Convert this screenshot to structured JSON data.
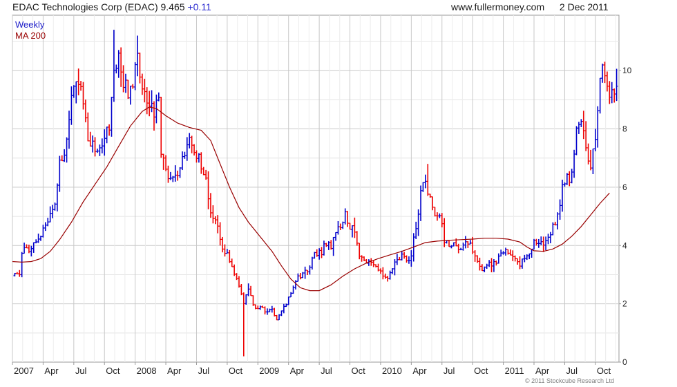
{
  "header": {
    "title": "EDAC Technologies Corp (EDAC)",
    "last_price": "9.465",
    "change": "+0.11",
    "source": "www.fullermoney.com",
    "date": "2 Dec 2011"
  },
  "copyright": "© 2011 Stockcube Research Ltd",
  "colors": {
    "up": "#0000cc",
    "down": "#ee0000",
    "ma": "#990000",
    "grid": "#d8d8d8",
    "legend_weekly": "#1a1ac8",
    "legend_ma": "#990000"
  },
  "chart_data": {
    "type": "candlestick-ohlc",
    "legend": [
      "Weekly",
      "MA 200"
    ],
    "grid": true,
    "legend_placement": "top-left",
    "ylim": [
      0,
      11.9
    ],
    "y_ticks": [
      0,
      2,
      4,
      6,
      8,
      10
    ],
    "x_labels": [
      "2007",
      "Apr",
      "Jul",
      "Oct",
      "2008",
      "Apr",
      "Jul",
      "Oct",
      "2009",
      "Apr",
      "Jul",
      "Oct",
      "2010",
      "Apr",
      "Jul",
      "Oct",
      "2011",
      "Apr",
      "Jul",
      "Oct"
    ],
    "x_start_week": 0,
    "x_end_week": 257,
    "price_path": [
      [
        0,
        3.0
      ],
      [
        3,
        3.1
      ],
      [
        4,
        3.8
      ],
      [
        7,
        3.9
      ],
      [
        10,
        4.0
      ],
      [
        12,
        4.4
      ],
      [
        15,
        4.8
      ],
      [
        18,
        5.4
      ],
      [
        20,
        7.0
      ],
      [
        22,
        7.1
      ],
      [
        24,
        8.5
      ],
      [
        26,
        9.5
      ],
      [
        28,
        9.3
      ],
      [
        30,
        9.0
      ],
      [
        32,
        7.8
      ],
      [
        34,
        7.5
      ],
      [
        37,
        7.4
      ],
      [
        39,
        7.5
      ],
      [
        41,
        8.2
      ],
      [
        43,
        10.2
      ],
      [
        45,
        10.5
      ],
      [
        47,
        9.5
      ],
      [
        49,
        9.2
      ],
      [
        51,
        9.5
      ],
      [
        53,
        10.3
      ],
      [
        55,
        9.2
      ],
      [
        58,
        9.0
      ],
      [
        60,
        8.5
      ],
      [
        62,
        9.0
      ],
      [
        63,
        7.0
      ],
      [
        66,
        6.4
      ],
      [
        68,
        6.3
      ],
      [
        71,
        6.6
      ],
      [
        73,
        7.2
      ],
      [
        75,
        7.7
      ],
      [
        77,
        7.4
      ],
      [
        79,
        6.9
      ],
      [
        82,
        6.2
      ],
      [
        84,
        5.0
      ],
      [
        87,
        4.6
      ],
      [
        89,
        4.0
      ],
      [
        91,
        3.7
      ],
      [
        93,
        3.2
      ],
      [
        96,
        2.7
      ],
      [
        98,
        2.0
      ],
      [
        100,
        2.5
      ],
      [
        103,
        1.8
      ],
      [
        105,
        1.9
      ],
      [
        108,
        1.7
      ],
      [
        110,
        1.8
      ],
      [
        112,
        1.5
      ],
      [
        114,
        1.7
      ],
      [
        117,
        2.2
      ],
      [
        120,
        2.8
      ],
      [
        123,
        3.0
      ],
      [
        126,
        3.3
      ],
      [
        128,
        3.7
      ],
      [
        131,
        3.8
      ],
      [
        133,
        4.1
      ],
      [
        135,
        3.9
      ],
      [
        137,
        4.5
      ],
      [
        139,
        4.6
      ],
      [
        141,
        5.0
      ],
      [
        143,
        4.7
      ],
      [
        145,
        4.5
      ],
      [
        147,
        3.7
      ],
      [
        149,
        3.5
      ],
      [
        151,
        3.5
      ],
      [
        153,
        3.3
      ],
      [
        155,
        3.1
      ],
      [
        157,
        3.0
      ],
      [
        159,
        2.9
      ],
      [
        161,
        3.2
      ],
      [
        163,
        3.5
      ],
      [
        165,
        3.6
      ],
      [
        167,
        3.5
      ],
      [
        169,
        3.7
      ],
      [
        171,
        4.6
      ],
      [
        173,
        5.8
      ],
      [
        175,
        6.1
      ],
      [
        177,
        5.6
      ],
      [
        179,
        5.0
      ],
      [
        181,
        5.2
      ],
      [
        183,
        4.2
      ],
      [
        185,
        4.0
      ],
      [
        187,
        4.1
      ],
      [
        189,
        3.9
      ],
      [
        191,
        4.0
      ],
      [
        193,
        4.1
      ],
      [
        195,
        3.8
      ],
      [
        197,
        3.5
      ],
      [
        199,
        3.2
      ],
      [
        201,
        3.3
      ],
      [
        203,
        3.4
      ],
      [
        205,
        3.5
      ],
      [
        207,
        3.7
      ],
      [
        209,
        3.8
      ],
      [
        211,
        3.6
      ],
      [
        213,
        3.5
      ],
      [
        215,
        3.4
      ],
      [
        217,
        3.5
      ],
      [
        219,
        3.6
      ],
      [
        221,
        4.1
      ],
      [
        223,
        4.2
      ],
      [
        225,
        4.1
      ],
      [
        227,
        4.4
      ],
      [
        229,
        4.6
      ],
      [
        231,
        5.0
      ],
      [
        233,
        6.1
      ],
      [
        235,
        6.3
      ],
      [
        237,
        6.4
      ],
      [
        239,
        7.8
      ],
      [
        241,
        8.3
      ],
      [
        243,
        7.4
      ],
      [
        245,
        6.8
      ],
      [
        247,
        7.5
      ],
      [
        249,
        10.0
      ],
      [
        251,
        9.8
      ],
      [
        253,
        9.0
      ],
      [
        255,
        9.2
      ],
      [
        256,
        9.465
      ]
    ],
    "ma200": [
      [
        0,
        3.45
      ],
      [
        4,
        3.43
      ],
      [
        8,
        3.45
      ],
      [
        12,
        3.55
      ],
      [
        16,
        3.8
      ],
      [
        20,
        4.2
      ],
      [
        25,
        4.8
      ],
      [
        30,
        5.5
      ],
      [
        35,
        6.1
      ],
      [
        40,
        6.7
      ],
      [
        45,
        7.4
      ],
      [
        50,
        8.1
      ],
      [
        55,
        8.6
      ],
      [
        58,
        8.75
      ],
      [
        61,
        8.7
      ],
      [
        65,
        8.45
      ],
      [
        70,
        8.2
      ],
      [
        75,
        8.05
      ],
      [
        80,
        7.95
      ],
      [
        84,
        7.6
      ],
      [
        88,
        6.8
      ],
      [
        92,
        6.0
      ],
      [
        96,
        5.3
      ],
      [
        100,
        4.8
      ],
      [
        105,
        4.3
      ],
      [
        110,
        3.8
      ],
      [
        114,
        3.3
      ],
      [
        118,
        2.85
      ],
      [
        122,
        2.55
      ],
      [
        126,
        2.45
      ],
      [
        130,
        2.45
      ],
      [
        135,
        2.65
      ],
      [
        140,
        2.95
      ],
      [
        145,
        3.2
      ],
      [
        150,
        3.4
      ],
      [
        155,
        3.55
      ],
      [
        160,
        3.68
      ],
      [
        165,
        3.8
      ],
      [
        170,
        3.95
      ],
      [
        175,
        4.1
      ],
      [
        180,
        4.15
      ],
      [
        185,
        4.18
      ],
      [
        190,
        4.2
      ],
      [
        195,
        4.22
      ],
      [
        200,
        4.25
      ],
      [
        205,
        4.25
      ],
      [
        210,
        4.22
      ],
      [
        215,
        4.12
      ],
      [
        218,
        3.95
      ],
      [
        221,
        3.82
      ],
      [
        225,
        3.8
      ],
      [
        229,
        3.88
      ],
      [
        233,
        4.05
      ],
      [
        237,
        4.32
      ],
      [
        241,
        4.65
      ],
      [
        245,
        5.05
      ],
      [
        249,
        5.45
      ],
      [
        253,
        5.8
      ]
    ]
  }
}
